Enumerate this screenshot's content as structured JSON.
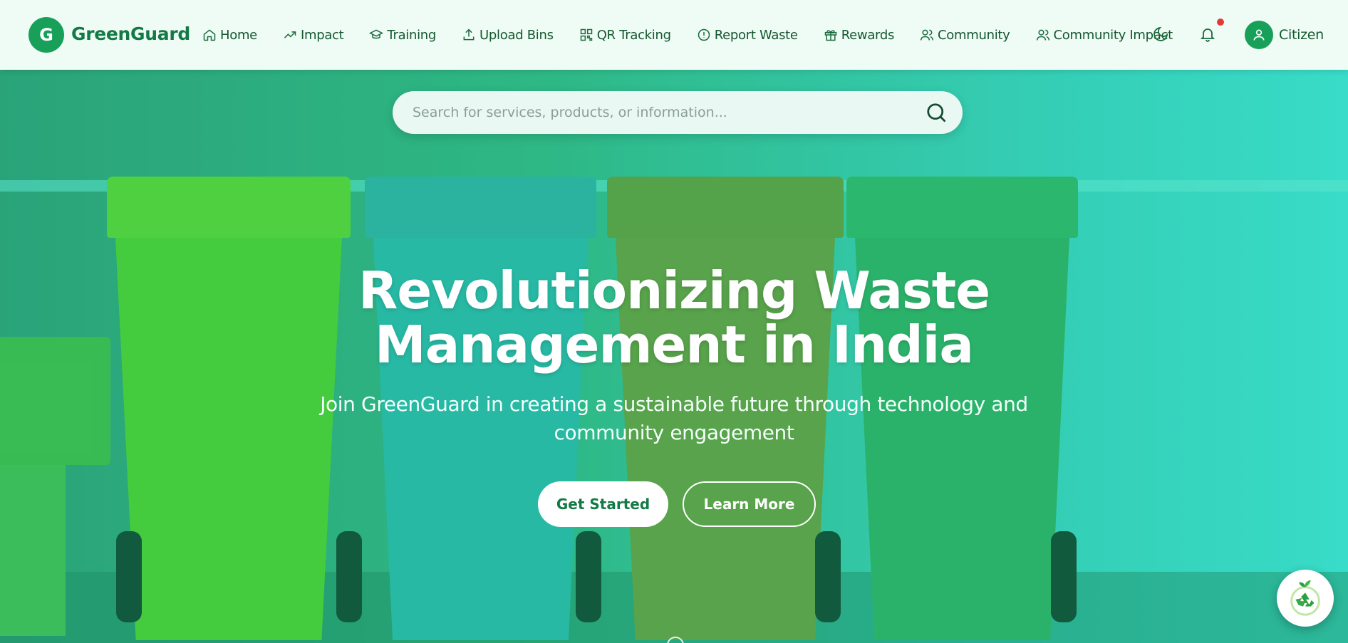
{
  "brand": {
    "initial": "G",
    "name": "GreenGuard"
  },
  "nav": {
    "items": [
      {
        "label": "Home",
        "icon": "home-icon"
      },
      {
        "label": "Impact",
        "icon": "trending-up-icon"
      },
      {
        "label": "Training",
        "icon": "graduation-cap-icon"
      },
      {
        "label": "Upload Bins",
        "icon": "upload-icon"
      },
      {
        "label": "QR Tracking",
        "icon": "qr-code-icon"
      },
      {
        "label": "Report Waste",
        "icon": "alert-circle-icon"
      },
      {
        "label": "Rewards",
        "icon": "gift-icon"
      },
      {
        "label": "Community",
        "icon": "users-icon"
      },
      {
        "label": "Community Impact",
        "icon": "users-icon"
      }
    ],
    "theme_toggle_icon": "moon-icon",
    "notifications_icon": "bell-icon",
    "has_unread_notifications": true,
    "user": {
      "role": "Citizen",
      "avatar_icon": "user-icon"
    }
  },
  "search": {
    "placeholder": "Search for services, products, or information...",
    "value": ""
  },
  "hero": {
    "headline_line1": "Revolutionizing Waste",
    "headline_line2": "Management in India",
    "subtitle_line1": "Join GreenGuard in creating a sustainable future through technology and",
    "subtitle_line2": "community engagement",
    "primary_button": "Get Started",
    "secondary_button": "Learn More"
  },
  "fab": {
    "icon": "recycle-icon"
  },
  "colors": {
    "brand": "#18a05a",
    "brand_dark": "#137a46",
    "nav_bg": "#effbf5",
    "notification_dot": "#e53935"
  }
}
